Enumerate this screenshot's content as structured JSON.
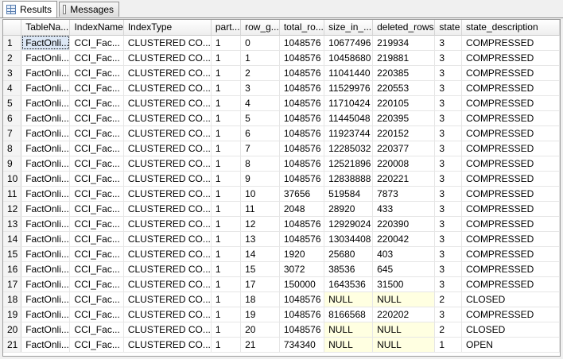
{
  "tabs": [
    {
      "label": "Results",
      "icon": "grid-icon",
      "active": true
    },
    {
      "label": "Messages",
      "icon": "messages-icon",
      "active": false
    }
  ],
  "grid": {
    "columns": [
      "TableNa...",
      "IndexName",
      "IndexType",
      "part...",
      "row_g...",
      "total_ro...",
      "size_in_...",
      "deleted_rows",
      "state",
      "state_description"
    ],
    "rows": [
      [
        "1",
        "FactOnli...",
        "CCI_Fac...",
        "CLUSTERED CO...",
        "1",
        "0",
        "1048576",
        "10677496",
        "219934",
        "3",
        "COMPRESSED"
      ],
      [
        "2",
        "FactOnli...",
        "CCI_Fac...",
        "CLUSTERED CO...",
        "1",
        "1",
        "1048576",
        "10458680",
        "219881",
        "3",
        "COMPRESSED"
      ],
      [
        "3",
        "FactOnli...",
        "CCI_Fac...",
        "CLUSTERED CO...",
        "1",
        "2",
        "1048576",
        "11041440",
        "220385",
        "3",
        "COMPRESSED"
      ],
      [
        "4",
        "FactOnli...",
        "CCI_Fac...",
        "CLUSTERED CO...",
        "1",
        "3",
        "1048576",
        "11529976",
        "220553",
        "3",
        "COMPRESSED"
      ],
      [
        "5",
        "FactOnli...",
        "CCI_Fac...",
        "CLUSTERED CO...",
        "1",
        "4",
        "1048576",
        "11710424",
        "220105",
        "3",
        "COMPRESSED"
      ],
      [
        "6",
        "FactOnli...",
        "CCI_Fac...",
        "CLUSTERED CO...",
        "1",
        "5",
        "1048576",
        "11445048",
        "220395",
        "3",
        "COMPRESSED"
      ],
      [
        "7",
        "FactOnli...",
        "CCI_Fac...",
        "CLUSTERED CO...",
        "1",
        "6",
        "1048576",
        "11923744",
        "220152",
        "3",
        "COMPRESSED"
      ],
      [
        "8",
        "FactOnli...",
        "CCI_Fac...",
        "CLUSTERED CO...",
        "1",
        "7",
        "1048576",
        "12285032",
        "220377",
        "3",
        "COMPRESSED"
      ],
      [
        "9",
        "FactOnli...",
        "CCI_Fac...",
        "CLUSTERED CO...",
        "1",
        "8",
        "1048576",
        "12521896",
        "220008",
        "3",
        "COMPRESSED"
      ],
      [
        "10",
        "FactOnli...",
        "CCI_Fac...",
        "CLUSTERED CO...",
        "1",
        "9",
        "1048576",
        "12838888",
        "220221",
        "3",
        "COMPRESSED"
      ],
      [
        "11",
        "FactOnli...",
        "CCI_Fac...",
        "CLUSTERED CO...",
        "1",
        "10",
        "37656",
        "519584",
        "7873",
        "3",
        "COMPRESSED"
      ],
      [
        "12",
        "FactOnli...",
        "CCI_Fac...",
        "CLUSTERED CO...",
        "1",
        "11",
        "2048",
        "28920",
        "433",
        "3",
        "COMPRESSED"
      ],
      [
        "13",
        "FactOnli...",
        "CCI_Fac...",
        "CLUSTERED CO...",
        "1",
        "12",
        "1048576",
        "12929024",
        "220390",
        "3",
        "COMPRESSED"
      ],
      [
        "14",
        "FactOnli...",
        "CCI_Fac...",
        "CLUSTERED CO...",
        "1",
        "13",
        "1048576",
        "13034408",
        "220042",
        "3",
        "COMPRESSED"
      ],
      [
        "15",
        "FactOnli...",
        "CCI_Fac...",
        "CLUSTERED CO...",
        "1",
        "14",
        "1920",
        "25680",
        "403",
        "3",
        "COMPRESSED"
      ],
      [
        "16",
        "FactOnli...",
        "CCI_Fac...",
        "CLUSTERED CO...",
        "1",
        "15",
        "3072",
        "38536",
        "645",
        "3",
        "COMPRESSED"
      ],
      [
        "17",
        "FactOnli...",
        "CCI_Fac...",
        "CLUSTERED CO...",
        "1",
        "17",
        "150000",
        "1643536",
        "31500",
        "3",
        "COMPRESSED"
      ],
      [
        "18",
        "FactOnli...",
        "CCI_Fac...",
        "CLUSTERED CO...",
        "1",
        "18",
        "1048576",
        "NULL",
        "NULL",
        "2",
        "CLOSED"
      ],
      [
        "19",
        "FactOnli...",
        "CCI_Fac...",
        "CLUSTERED CO...",
        "1",
        "19",
        "1048576",
        "8166568",
        "220202",
        "3",
        "COMPRESSED"
      ],
      [
        "20",
        "FactOnli...",
        "CCI_Fac...",
        "CLUSTERED CO...",
        "1",
        "20",
        "1048576",
        "NULL",
        "NULL",
        "2",
        "CLOSED"
      ],
      [
        "21",
        "FactOnli...",
        "CCI_Fac...",
        "CLUSTERED CO...",
        "1",
        "21",
        "734340",
        "NULL",
        "NULL",
        "1",
        "OPEN"
      ]
    ]
  }
}
